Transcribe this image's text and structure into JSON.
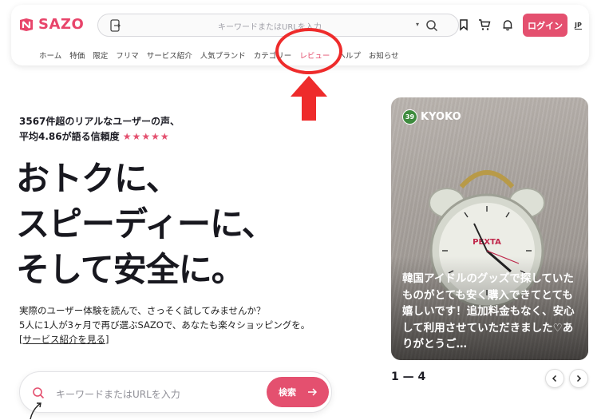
{
  "brand": {
    "name": "SAZO",
    "color": "#e8456b"
  },
  "header": {
    "search_placeholder": "キーワードまたはURLを入力",
    "login_label": "ログイン",
    "language": "JP",
    "nav_items": [
      {
        "label": "ホーム"
      },
      {
        "label": "特価"
      },
      {
        "label": "限定"
      },
      {
        "label": "フリマ"
      },
      {
        "label": "サービス紹介"
      },
      {
        "label": "人気ブランド"
      },
      {
        "label": "カテゴリー"
      },
      {
        "label": "レビュー",
        "active": true
      },
      {
        "label": "ヘルプ"
      },
      {
        "label": "お知らせ"
      }
    ]
  },
  "hero": {
    "sub_line1": "3567件超のリアルなユーザーの声、",
    "sub_line2": "平均4.86が語る信頼度",
    "stars": "★★★★★",
    "title_line1": "おトクに、",
    "title_line2": "スピーディーに、",
    "title_line3": "そして安全に。",
    "desc_line1": "実際のユーザー体験を読んで、さっそく試してみませんか？",
    "desc_line2": "5人に1人が3ヶ月で再び選ぶSAZOで、あなたも楽々ショッピングを。",
    "desc_link": "[サービス紹介を見る]",
    "search_placeholder": "キーワードまたはURLを入力",
    "search_button": "検索"
  },
  "review_card": {
    "level": "39",
    "reviewer": "KYOKO",
    "text": "韓国アイドルのグッズで探していたものがとても安く購入できてとても嬉しいです！追加料金もなく、安心して利用させていただきました♡ありがとうご…",
    "clock_brand": "PEXTA"
  },
  "pager": {
    "current": "1",
    "separator": "—",
    "total": "4"
  },
  "colors": {
    "accent": "#e4506f",
    "annotation": "#ee2b2b"
  },
  "icons": [
    "doc-icon",
    "search-icon",
    "bookmark-icon",
    "cart-icon",
    "bell-icon",
    "arrow-right-icon",
    "chevron-left-icon",
    "chevron-right-icon"
  ]
}
